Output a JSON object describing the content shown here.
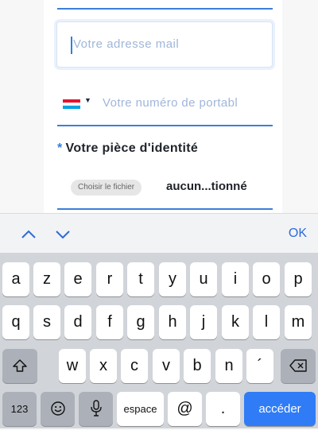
{
  "form": {
    "email_placeholder": "Votre adresse mail",
    "phone_placeholder": "Votre numéro de portabl",
    "country_flag": "flag-luxembourg-icon",
    "id_label_prefix": "*",
    "id_label": "Votre pièce d'identité",
    "file_button_label": "Choisir le fichier",
    "file_status": "aucun...tionné",
    "accent_color": "#3b7fd8"
  },
  "keyboard_toolbar": {
    "prev_icon": "chevron-up-icon",
    "next_icon": "chevron-down-icon",
    "done_label": "OK"
  },
  "keyboard": {
    "row1": [
      "a",
      "z",
      "e",
      "r",
      "t",
      "y",
      "u",
      "i",
      "o",
      "p"
    ],
    "row2": [
      "q",
      "s",
      "d",
      "f",
      "g",
      "h",
      "j",
      "k",
      "l",
      "m"
    ],
    "row3": [
      "w",
      "x",
      "c",
      "v",
      "b",
      "n",
      "´"
    ],
    "shift_icon": "shift-icon",
    "delete_icon": "backspace-icon",
    "numbers_label": "123",
    "emoji_icon": "emoji-icon",
    "mic_icon": "microphone-icon",
    "space_label": "espace",
    "at_label": "@",
    "dot_label": ".",
    "go_label": "accéder"
  }
}
